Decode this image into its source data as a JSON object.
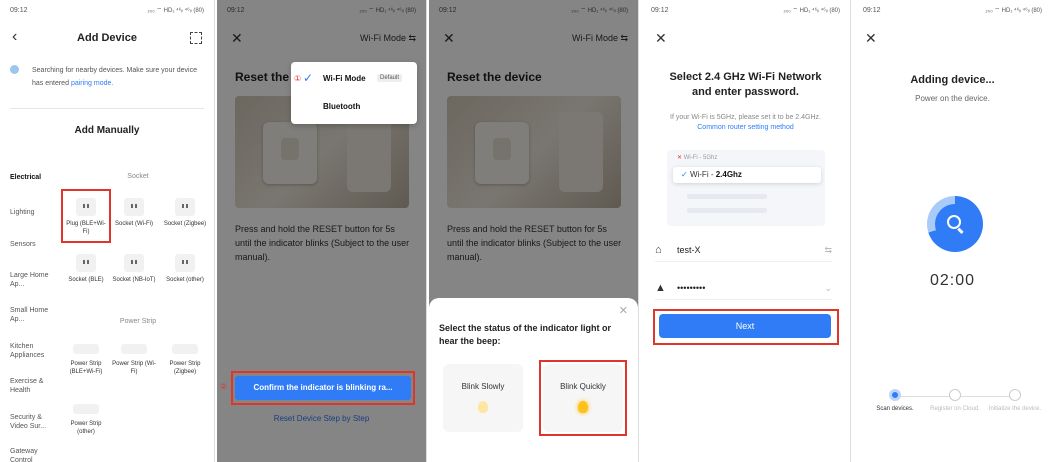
{
  "status_bar": {
    "time": "09:12",
    "left_icons": "Ø 60ₙ ✱",
    "right_icons": "₂₀₀ ⌔ HD₁ ⁴⁶ᵢₗ ⁴⁶ᵢₗ (80)"
  },
  "colors": {
    "accent": "#2f7cf6",
    "highlight": "#e0352b",
    "bulb": "#ffc21a"
  },
  "panel1": {
    "title": "Add Device",
    "back_icon": "chevron-left-icon",
    "scan_icon": "scan-icon",
    "search_text": "Searching for nearby devices. Make sure your device has entered",
    "search_link": "pairing mode.",
    "add_manually": "Add Manually",
    "categories": [
      "Electrical",
      "Lighting",
      "Sensors",
      "Large Home Ap...",
      "Small Home Ap...",
      "Kitchen Appliances",
      "Exercise & Health",
      "Security & Video Sur...",
      "Gateway Control"
    ],
    "sections": {
      "socket": "Socket",
      "power_strip": "Power Strip"
    },
    "sockets": [
      "Plug (BLE+Wi-Fi)",
      "Socket (Wi-Fi)",
      "Socket (Zigbee)",
      "Socket (BLE)",
      "Socket (NB-IoT)",
      "Socket (other)"
    ],
    "strips": [
      "Power Strip (BLE+Wi-Fi)",
      "Power Strip (Wi-Fi)",
      "Power Strip (Zigbee)",
      "Power Strip (other)"
    ]
  },
  "panel2": {
    "close_icon": "close-icon",
    "mode_label": "Wi-Fi Mode ⇆",
    "title": "Reset the device",
    "desc": "Press and hold the RESET button for 5s until the indicator blinks (Subject to the user manual).",
    "menu": {
      "wifi": "Wi-Fi Mode",
      "default_badge": "Default",
      "bluetooth": "Bluetooth",
      "marker1": "①",
      "marker2": "②"
    },
    "confirm_btn": "Confirm the indicator is blinking ra...",
    "step_link": "Reset Device Step by Step"
  },
  "panel3": {
    "mode_label": "Wi-Fi Mode ⇆",
    "title": "Reset the device",
    "desc": "Press and hold the RESET button for 5s until the indicator blinks (Subject to the user manual).",
    "sheet_title": "Select the status of the indicator light or hear the beep:",
    "blink_slow": "Blink Slowly",
    "blink_fast": "Blink Quickly"
  },
  "panel4": {
    "title_line1": "Select 2.4 GHz Wi-Fi Network",
    "title_line2": "and enter password.",
    "sub": "If your Wi-Fi is 5GHz, please set it to be 2.4GHz.",
    "sub_link": "Common router setting method",
    "wifi_5g": "Wi-Fi - 5Ghz",
    "wifi_24_prefix": "Wi-Fi - ",
    "wifi_24": "2.4Ghz",
    "ssid": "test-X",
    "password": "•••••••••",
    "next_btn": "Next"
  },
  "panel5": {
    "title": "Adding device...",
    "sub": "Power on the device.",
    "timer": "02:00",
    "steps": [
      "Scan devices.",
      "Register on Cloud.",
      "Initialize the device."
    ]
  }
}
